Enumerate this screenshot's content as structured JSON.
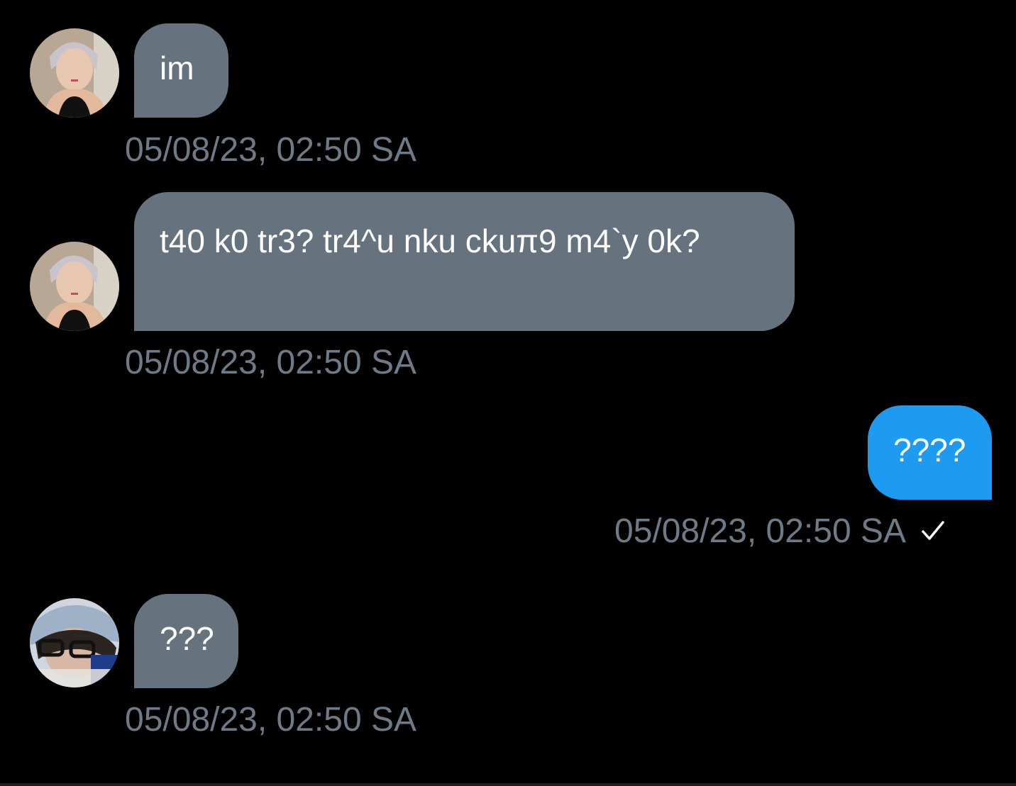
{
  "messages": [
    {
      "direction": "incoming",
      "avatar": "avatar-sender-a",
      "text": "im",
      "timestamp": "05/08/23, 02:50 SA"
    },
    {
      "direction": "incoming",
      "avatar": "avatar-sender-a",
      "text": "t40 k0 tr3? tr4^u nku ckuπ9 m4`y 0k?",
      "timestamp": "05/08/23, 02:50 SA"
    },
    {
      "direction": "outgoing",
      "text": "????",
      "timestamp": "05/08/23, 02:50 SA",
      "status_icon": "checkmark-icon"
    },
    {
      "direction": "incoming",
      "avatar": "avatar-sender-b",
      "text": "???",
      "timestamp": "05/08/23, 02:50 SA"
    }
  ],
  "colors": {
    "background": "#000000",
    "incoming_bubble": "#66737f",
    "outgoing_bubble": "#1d9bf0",
    "timestamp": "#6e7b86",
    "message_text": "#ffffff"
  }
}
